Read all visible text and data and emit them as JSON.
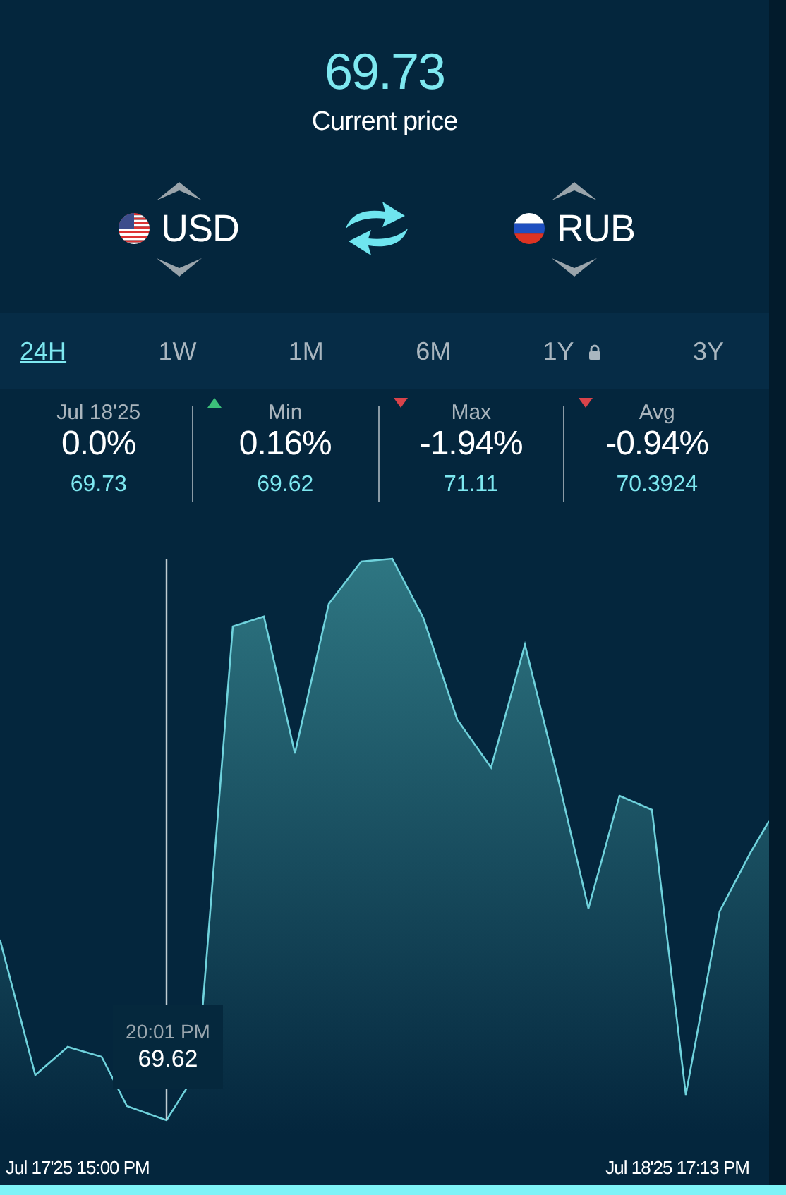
{
  "price": {
    "value": "69.73",
    "label": "Current price"
  },
  "pair": {
    "from": {
      "code": "USD",
      "kind": "us"
    },
    "to": {
      "code": "RUB",
      "kind": "ru"
    }
  },
  "tabs": [
    {
      "label": "24H",
      "selected": true,
      "locked": false
    },
    {
      "label": "1W",
      "selected": false,
      "locked": false
    },
    {
      "label": "1M",
      "selected": false,
      "locked": false
    },
    {
      "label": "6M",
      "selected": false,
      "locked": false
    },
    {
      "label": "1Y",
      "selected": false,
      "locked": true
    },
    {
      "label": "3Y",
      "selected": false,
      "locked": false
    }
  ],
  "stats": [
    {
      "label": "Jul 18'25",
      "percent": "0.0%",
      "value": "69.73",
      "kind": "none"
    },
    {
      "label": "Min",
      "percent": "0.16%",
      "value": "69.62",
      "kind": "up"
    },
    {
      "label": "Max",
      "percent": "-1.94%",
      "value": "71.11",
      "kind": "down"
    },
    {
      "label": "Avg",
      "percent": "-0.94%",
      "value": "70.3924",
      "kind": "down"
    }
  ],
  "chart": {
    "tooltip": {
      "time": "20:01 PM",
      "value": "69.62"
    },
    "start_label": "Jul 17'25 15:00 PM",
    "end_label": "Jul 18'25 17:13 PM"
  }
}
